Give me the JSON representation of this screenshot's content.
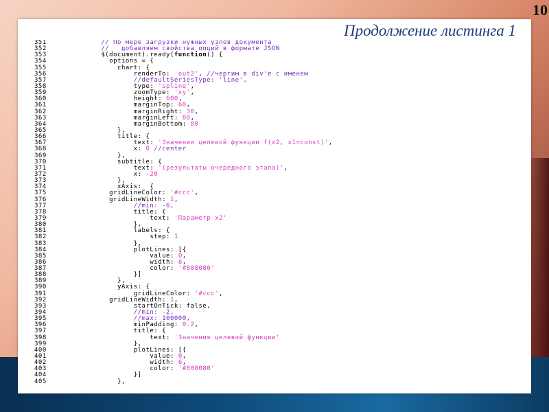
{
  "slide_number": "10",
  "title": "Продолжение листинга 1",
  "code_lines": [
    {
      "n": "351",
      "t": "        // По мере загрузки нужных узлов документа"
    },
    {
      "n": "352",
      "t": "        //   добавляем свойства опций в формате JSON"
    },
    {
      "n": "353",
      "t": "        $(document).ready(function() {"
    },
    {
      "n": "354",
      "t": "          options = {"
    },
    {
      "n": "355",
      "t": "            chart: {"
    },
    {
      "n": "356",
      "t": "                renderTo: 'out2', //чертим в div'e с именем"
    },
    {
      "n": "357",
      "t": "                //defaultSeriesType: 'line',"
    },
    {
      "n": "358",
      "t": "                type: 'spline',"
    },
    {
      "n": "359",
      "t": "                zoomType: 'xy',"
    },
    {
      "n": "360",
      "t": "                height: 600,"
    },
    {
      "n": "361",
      "t": "                marginTop: 60,"
    },
    {
      "n": "362",
      "t": "                marginRight: 30,"
    },
    {
      "n": "363",
      "t": "                marginLeft: 80,"
    },
    {
      "n": "364",
      "t": "                marginBottom: 80"
    },
    {
      "n": "365",
      "t": "            },"
    },
    {
      "n": "366",
      "t": "            title: {"
    },
    {
      "n": "367",
      "t": "                text: 'Значения целевой функции f(x2, x1=const)',"
    },
    {
      "n": "368",
      "t": "                x: 0 //center"
    },
    {
      "n": "369",
      "t": "            },"
    },
    {
      "n": "370",
      "t": "            subtitle: {"
    },
    {
      "n": "371",
      "t": "                text: '(результаты очередного этапа)',"
    },
    {
      "n": "372",
      "t": "                x: -20"
    },
    {
      "n": "373",
      "t": "            },"
    },
    {
      "n": "374",
      "t": "            xAxis:  {"
    },
    {
      "n": "375",
      "t": "          gridLineColor: '#ccc',"
    },
    {
      "n": "376",
      "t": "          gridLineWidth: 1,"
    },
    {
      "n": "377",
      "t": "                //min: -6,"
    },
    {
      "n": "378",
      "t": "                title: {"
    },
    {
      "n": "379",
      "t": "                    text: 'Параметр x2'"
    },
    {
      "n": "380",
      "t": "                },"
    },
    {
      "n": "381",
      "t": "                labels: {"
    },
    {
      "n": "382",
      "t": "                    step: 1"
    },
    {
      "n": "383",
      "t": "                },"
    },
    {
      "n": "384",
      "t": "                plotLines: [{"
    },
    {
      "n": "385",
      "t": "                    value: 0,"
    },
    {
      "n": "386",
      "t": "                    width: 6,"
    },
    {
      "n": "387",
      "t": "                    color: '#808080'"
    },
    {
      "n": "388",
      "t": "                }]"
    },
    {
      "n": "389",
      "t": "            },"
    },
    {
      "n": "390",
      "t": "            yAxis: {"
    },
    {
      "n": "391",
      "t": "                gridLineColor: '#ccc',"
    },
    {
      "n": "392",
      "t": "          gridLineWidth: 1,"
    },
    {
      "n": "393",
      "t": "                startOnTick: false,"
    },
    {
      "n": "394",
      "t": "                //min: -2,"
    },
    {
      "n": "395",
      "t": "                //max: 100000,"
    },
    {
      "n": "396",
      "t": "                minPadding: 0.2,"
    },
    {
      "n": "397",
      "t": "                title: {"
    },
    {
      "n": "398",
      "t": "                    text: 'Значения целевой функции'"
    },
    {
      "n": "399",
      "t": "                },"
    },
    {
      "n": "400",
      "t": "                plotLines: [{"
    },
    {
      "n": "401",
      "t": "                    value: 0,"
    },
    {
      "n": "402",
      "t": "                    width: 6,"
    },
    {
      "n": "403",
      "t": "                    color: '#808080'"
    },
    {
      "n": "404",
      "t": "                }]"
    },
    {
      "n": "405",
      "t": "            },"
    }
  ],
  "colors": {
    "title": "#1f3a7a",
    "comment": "#7a2cc0",
    "string": "#d63abf"
  }
}
